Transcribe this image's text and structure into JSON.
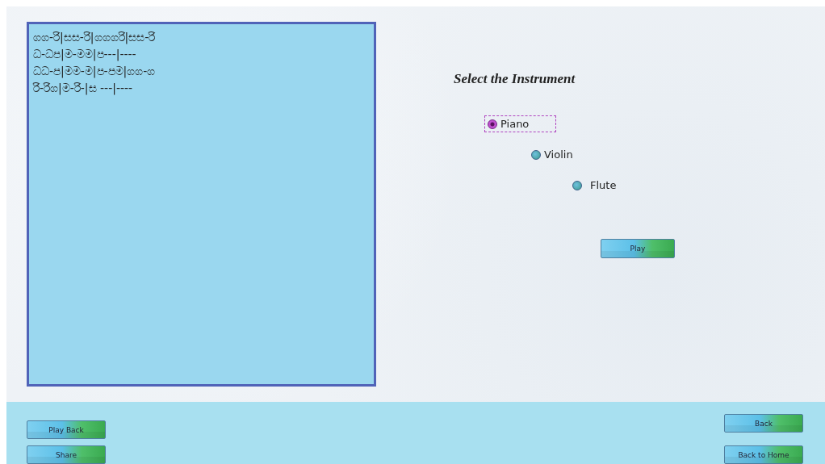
{
  "notation": {
    "lines": [
      "ගග-රි|සස-රි|ගගගරි|සස-රි",
      "ධ-ධප|ම-මම|ප---|----",
      "ධධ-ප|මම-ම|ප-පම|ගග-ග",
      "රි-රිග|ම-රි-|ස ---|----"
    ]
  },
  "instrument_panel": {
    "title": "Select the Instrument",
    "options": [
      {
        "label": "Piano",
        "selected": true
      },
      {
        "label": "Violin",
        "selected": false
      },
      {
        "label": "Flute",
        "selected": false
      }
    ],
    "play_button": "Play"
  },
  "bottom_bar": {
    "left_buttons": [
      "Play Back",
      "Share"
    ],
    "right_buttons": [
      "Back",
      "Back to Home"
    ]
  }
}
